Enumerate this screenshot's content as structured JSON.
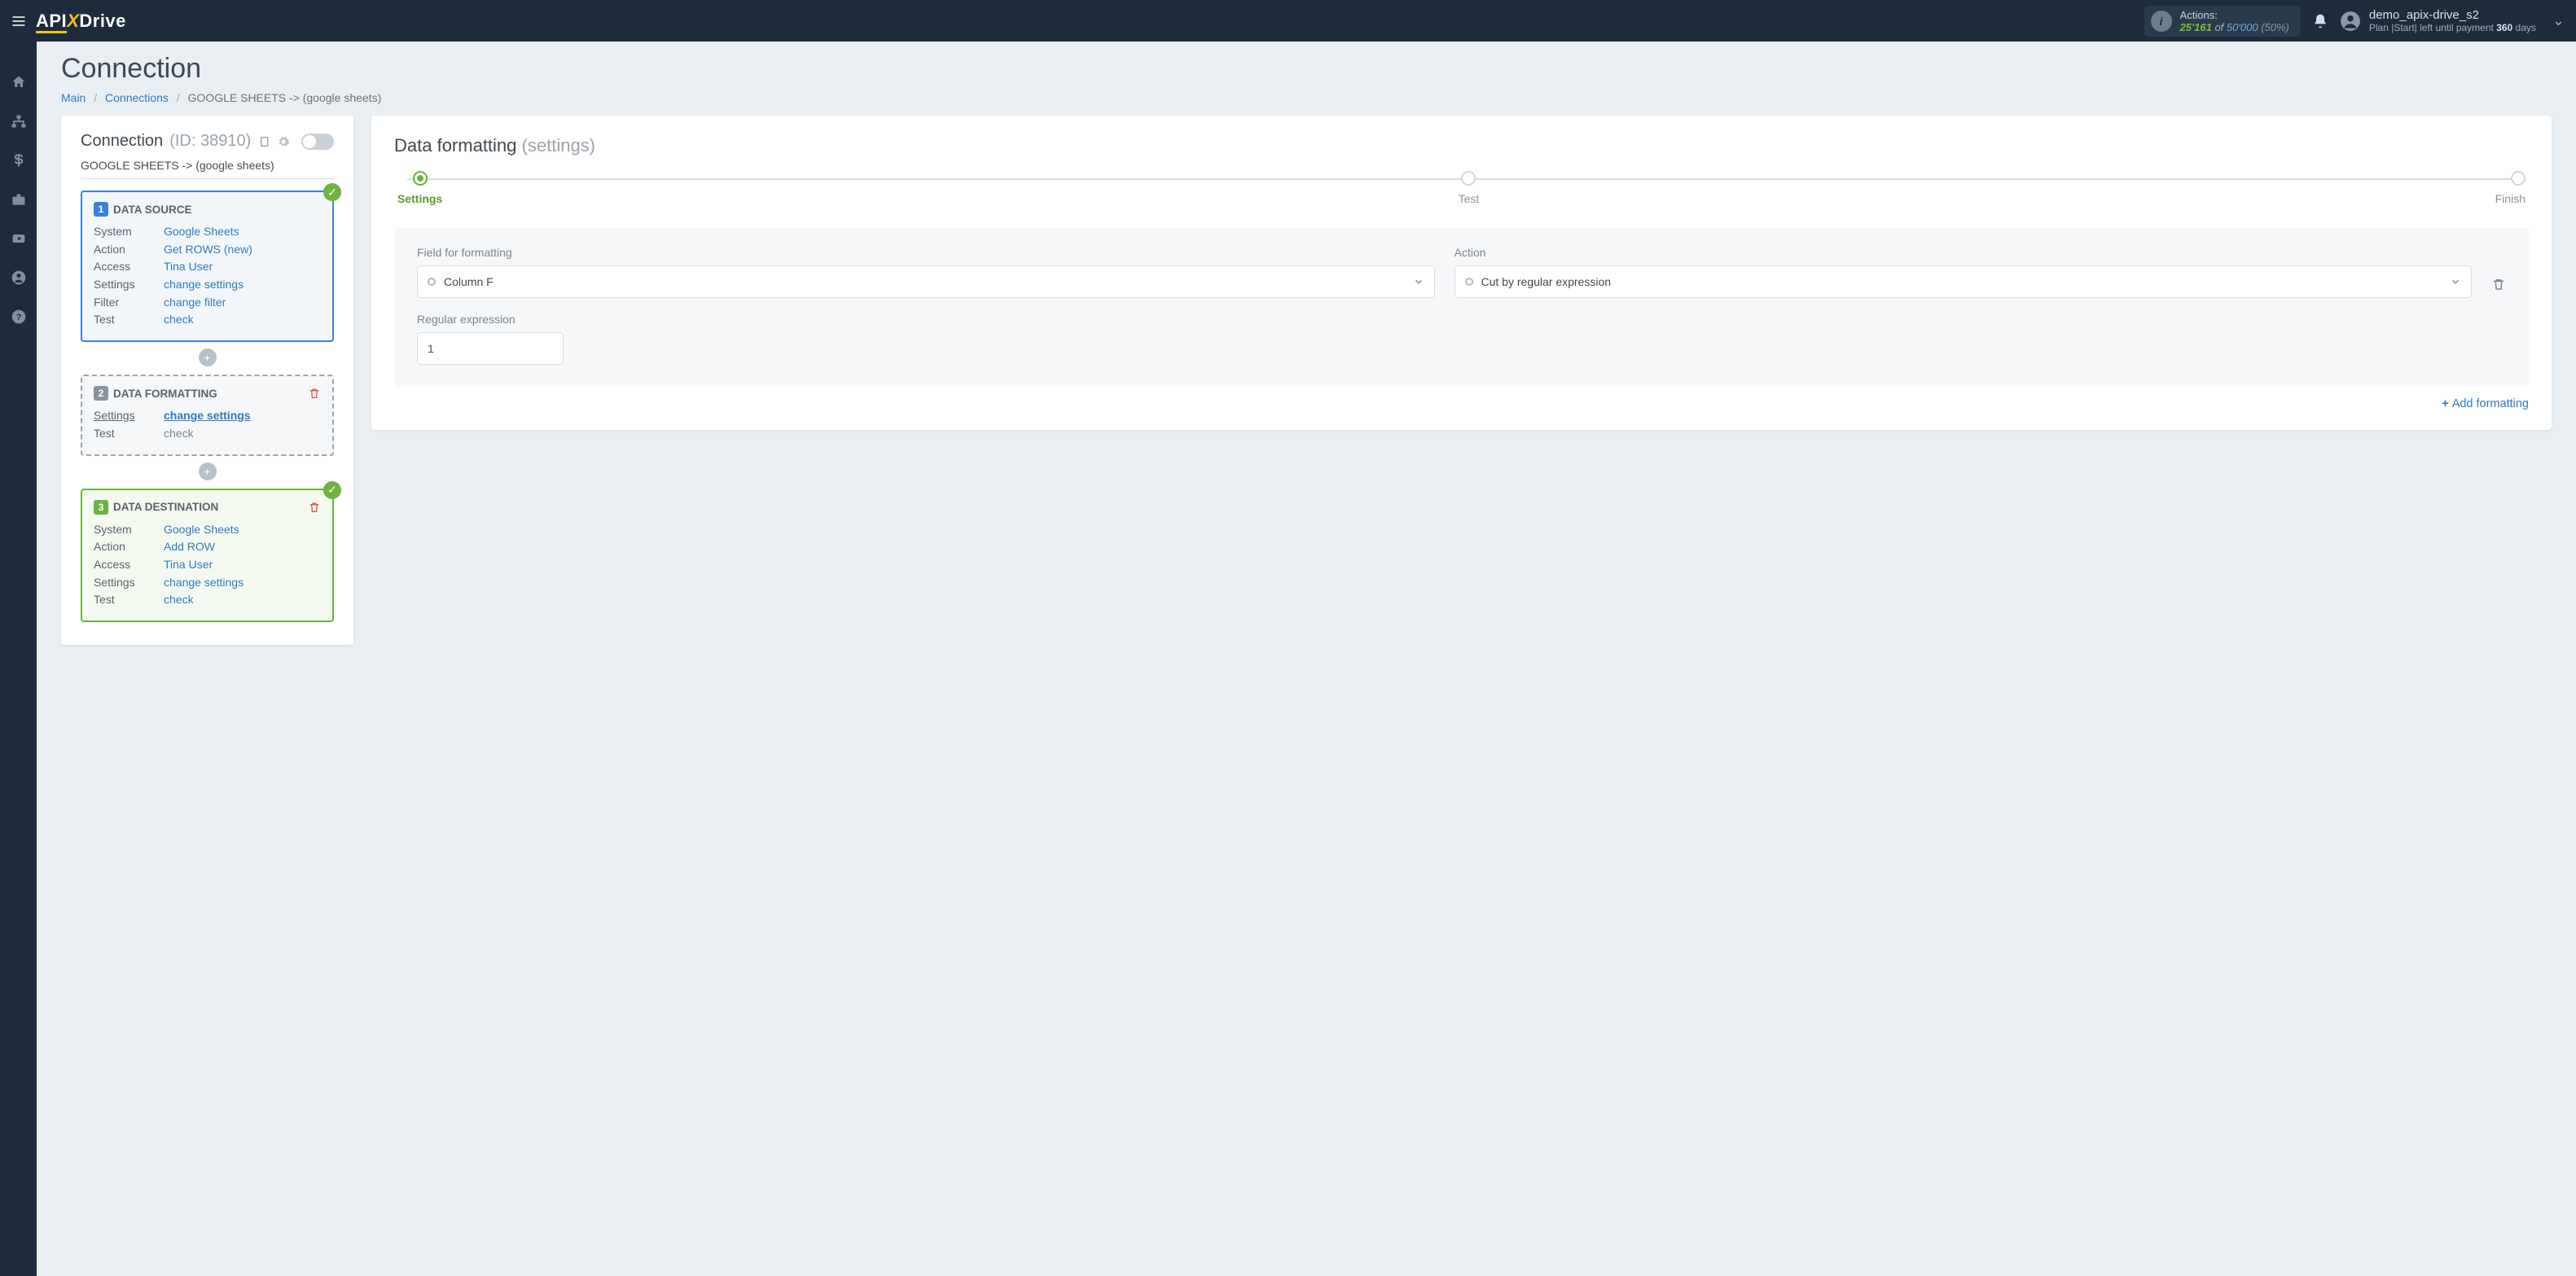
{
  "header": {
    "actions_label": "Actions:",
    "actions_used": "25'161",
    "actions_of": "of",
    "actions_total": "50'000",
    "actions_pct": "(50%)",
    "username": "demo_apix-drive_s2",
    "plan_prefix": "Plan |Start| left until payment ",
    "plan_days": "360",
    "plan_suffix": " days"
  },
  "page": {
    "title": "Connection",
    "crumb_main": "Main",
    "crumb_conn": "Connections",
    "crumb_current": "GOOGLE SHEETS -> (google sheets)"
  },
  "left": {
    "title": "Connection",
    "id": "(ID: 38910)",
    "subpath": "GOOGLE SHEETS -> (google sheets)",
    "source": {
      "num": "1",
      "title": "DATA SOURCE",
      "rows": [
        {
          "k": "System",
          "v": "Google Sheets"
        },
        {
          "k": "Action",
          "v": "Get ROWS (new)"
        },
        {
          "k": "Access",
          "v": "Tina User"
        },
        {
          "k": "Settings",
          "v": "change settings"
        },
        {
          "k": "Filter",
          "v": "change filter"
        },
        {
          "k": "Test",
          "v": "check"
        }
      ]
    },
    "format": {
      "num": "2",
      "title": "DATA FORMATTING",
      "rows": [
        {
          "k": "Settings",
          "v": "change settings",
          "active": true
        },
        {
          "k": "Test",
          "v": "check",
          "muted": true
        }
      ]
    },
    "dest": {
      "num": "3",
      "title": "DATA DESTINATION",
      "rows": [
        {
          "k": "System",
          "v": "Google Sheets"
        },
        {
          "k": "Action",
          "v": "Add ROW"
        },
        {
          "k": "Access",
          "v": "Tina User"
        },
        {
          "k": "Settings",
          "v": "change settings"
        },
        {
          "k": "Test",
          "v": "check"
        }
      ]
    }
  },
  "right": {
    "title": "Data formatting",
    "title_sub": "(settings)",
    "steps": [
      "Settings",
      "Test",
      "Finish"
    ],
    "field_label": "Field for formatting",
    "field_value": "Column F",
    "action_label": "Action",
    "action_value": "Cut by regular expression",
    "regex_label": "Regular expression",
    "regex_value": "1",
    "add_link": "Add formatting"
  }
}
